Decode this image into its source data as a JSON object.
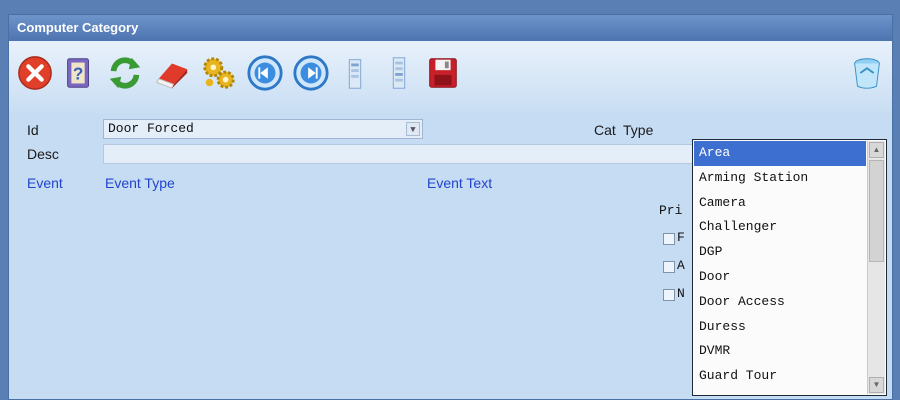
{
  "window": {
    "title": "Computer Category"
  },
  "toolbar": {
    "buttons": [
      {
        "name": "close-icon",
        "color": "#e0402a"
      },
      {
        "name": "help-book-icon",
        "color": "#6a55a8"
      },
      {
        "name": "refresh-icon",
        "color": "#3a9a34"
      },
      {
        "name": "eraser-icon",
        "color": "#d8342a"
      },
      {
        "name": "gears-icon",
        "color": "#e0b020"
      },
      {
        "name": "previous-icon",
        "color": "#3c8de0"
      },
      {
        "name": "next-icon",
        "color": "#3c8de0"
      },
      {
        "name": "page-up-icon",
        "color": "#7ea4cf"
      },
      {
        "name": "page-down-icon",
        "color": "#7ea4cf"
      },
      {
        "name": "save-icon",
        "color": "#c8202a"
      },
      {
        "name": "recycle-bin-icon",
        "color": "#4aa0d8"
      }
    ]
  },
  "form": {
    "id_label": "Id",
    "id_value": "Door Forced",
    "desc_label": "Desc",
    "cat_label": "Cat",
    "type_label": "Type",
    "event_header": "Event",
    "event_type_header": "Event Type",
    "event_text_header": "Event Text",
    "pri_partial": "Pri",
    "cb_partial_1": "F",
    "cb_partial_2": "A",
    "cb_partial_3": "N"
  },
  "type_dropdown": {
    "selected_index": 0,
    "items": [
      "Area",
      "Arming Station",
      "Camera",
      "Challenger",
      "DGP",
      "Door",
      "Door Access",
      "Duress",
      "DVMR",
      "Guard Tour"
    ]
  },
  "colors": {
    "accent": "#3d6fd0",
    "header_blue": "#2244cc",
    "panel_bg": "#c6dcf3"
  }
}
